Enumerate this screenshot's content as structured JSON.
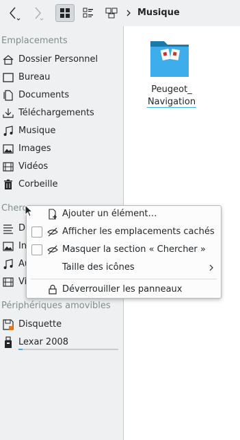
{
  "toolbar": {
    "breadcrumb_current": "Musique"
  },
  "places": {
    "section_locations": "Emplacements",
    "locations": [
      {
        "label": "Dossier Personnel",
        "icon": "home-icon"
      },
      {
        "label": "Bureau",
        "icon": "desktop-icon"
      },
      {
        "label": "Documents",
        "icon": "documents-icon"
      },
      {
        "label": "Téléchargements",
        "icon": "download-icon"
      },
      {
        "label": "Musique",
        "icon": "music-icon"
      },
      {
        "label": "Images",
        "icon": "images-icon"
      },
      {
        "label": "Vidéos",
        "icon": "video-icon"
      },
      {
        "label": "Corbeille",
        "icon": "trash-icon"
      }
    ],
    "section_search_partial": "Cherc",
    "search_items_partial": [
      {
        "label": "D",
        "icon": "documents-list-icon"
      },
      {
        "label": "In",
        "icon": "images-icon"
      },
      {
        "label": "Au",
        "icon": "music-icon"
      },
      {
        "label": "Vi",
        "icon": "video-icon"
      }
    ],
    "section_removable": "Périphériques amovibles",
    "removable": [
      {
        "label": "Disquette",
        "icon": "floppy-icon"
      },
      {
        "label": "Lexar 2008",
        "icon": "usb-drive-icon",
        "capacity_fill": 0.04
      }
    ]
  },
  "content": {
    "files": [
      {
        "name_line1": "Peugeot_",
        "name_line2": "Navigation",
        "icon": "folder-icon"
      }
    ]
  },
  "context_menu": {
    "items": [
      {
        "label": "Ajouter un élément…",
        "icon": "add-entry-icon",
        "checkbox": false
      },
      {
        "label": "Afficher les emplacements cachés",
        "icon": "hidden-eye-icon",
        "checkbox": true,
        "checked": false
      },
      {
        "label": "Masquer la section « Chercher »",
        "icon": "hidden-eye-icon",
        "checkbox": true,
        "checked": false
      },
      {
        "label": "Taille des icônes",
        "submenu": true
      },
      {
        "label": "Déverrouiller les panneaux",
        "icon": "lock-icon"
      }
    ]
  },
  "colors": {
    "accent": "#3daee9",
    "folder": "#3daee9",
    "background": "#eff0f1",
    "text": "#232629",
    "section_title": "#7f8c8d"
  }
}
